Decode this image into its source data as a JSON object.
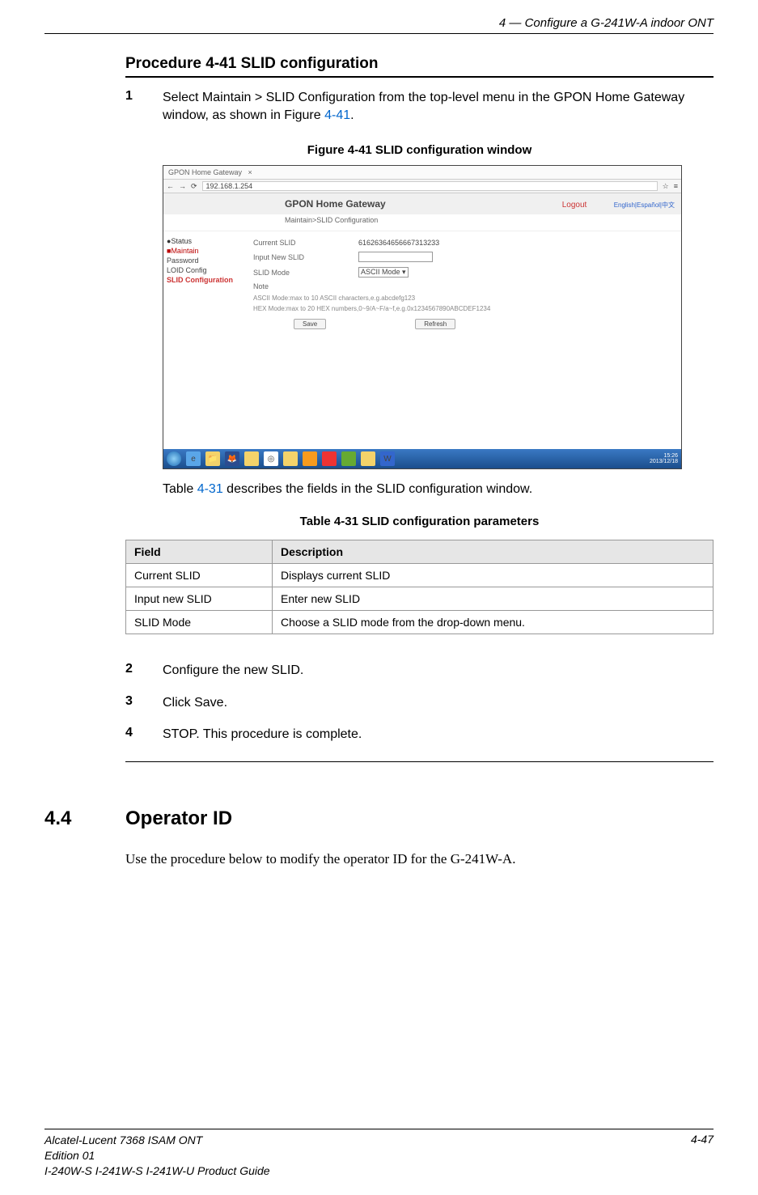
{
  "header": {
    "right": "4 —  Configure a G-241W-A indoor ONT"
  },
  "procedure": {
    "title": "Procedure 4-41  SLID configuration",
    "step1": {
      "num": "1",
      "text_a": "Select Maintain > SLID Configuration from the top-level menu in the GPON Home Gateway window, as shown in Figure ",
      "link": "4-41",
      "text_b": "."
    },
    "fig_caption": "Figure 4-41  SLID configuration window",
    "screenshot": {
      "tab_title": "GPON Home Gateway",
      "address": "192.168.1.254",
      "banner_title": "GPON Home Gateway",
      "logout": "Logout",
      "langs": "English|Español|中文",
      "breadcrumb": "Maintain>SLID Configuration",
      "sidebar": {
        "status": "Status",
        "maintain": "Maintain",
        "password": "Password",
        "loid": "LOID Config",
        "slid": "SLID Configuration"
      },
      "rows": {
        "current_label": "Current SLID",
        "current_value": "61626364656667313233",
        "input_label": "Input New SLID",
        "mode_label": "SLID Mode",
        "mode_value": "ASCII Mode",
        "note_label": "Note",
        "note_ascii": "ASCII Mode:max to 10 ASCII characters,e.g.abcdefg123",
        "note_hex": "HEX Mode:max to 20 HEX numbers,0~9/A~F/a~f,e.g.0x1234567890ABCDEF1234"
      },
      "buttons": {
        "save": "Save",
        "refresh": "Refresh"
      },
      "time": "15:26",
      "date": "2013/12/18"
    },
    "post_fig_a": "Table ",
    "post_fig_link": "4-31",
    "post_fig_b": " describes the fields in the SLID configuration window.",
    "table_caption": "Table 4-31 SLID configuration parameters",
    "table": {
      "h1": "Field",
      "h2": "Description",
      "rows": [
        {
          "field": "Current SLID",
          "desc": "Displays current SLID"
        },
        {
          "field": "Input new SLID",
          "desc": "Enter new SLID"
        },
        {
          "field": "SLID Mode",
          "desc": "Choose a SLID mode from the drop-down menu."
        }
      ]
    },
    "step2": {
      "num": "2",
      "text": "Configure the new SLID."
    },
    "step3": {
      "num": "3",
      "text": "Click Save."
    },
    "step4": {
      "num": "4",
      "text": "STOP. This procedure is complete."
    }
  },
  "section": {
    "num": "4.4",
    "title": "Operator ID",
    "body": "Use the procedure below to modify the operator ID for the G-241W-A."
  },
  "footer": {
    "line1": "Alcatel-Lucent 7368 ISAM ONT",
    "line2": "Edition 01",
    "line3": "I-240W-S I-241W-S I-241W-U Product Guide",
    "page": "4-47"
  }
}
